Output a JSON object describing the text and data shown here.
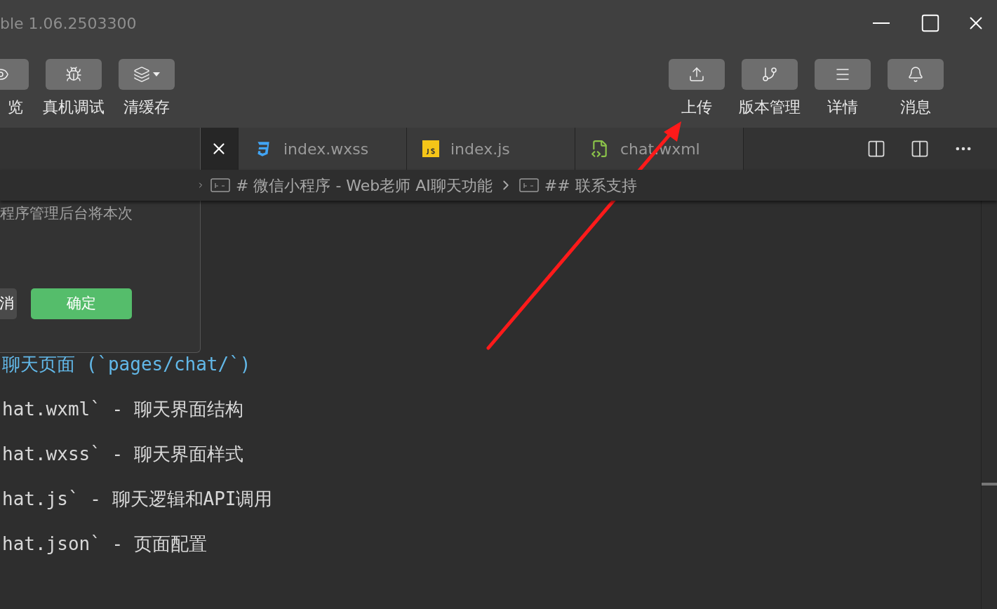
{
  "window": {
    "title": "ble 1.06.2503300"
  },
  "toolbar_left": [
    {
      "label": "览",
      "kind": "eye"
    },
    {
      "label": "真机调试",
      "kind": "bug"
    },
    {
      "label": "清缓存",
      "kind": "layers"
    }
  ],
  "toolbar_right": [
    {
      "label": "上传",
      "kind": "upload"
    },
    {
      "label": "版本管理",
      "kind": "branch"
    },
    {
      "label": "详情",
      "kind": "menu"
    },
    {
      "label": "消息",
      "kind": "bell"
    }
  ],
  "dialog": {
    "text": "程序管理后台将本次",
    "buttons": [
      {
        "label": "消",
        "kind": "secondary"
      },
      {
        "label": "确定",
        "kind": "primary"
      }
    ]
  },
  "tabs": [
    {
      "selected": true,
      "kind": "close"
    },
    {
      "label": "index.wxss",
      "kind": "css",
      "selected": false
    },
    {
      "label": "index.js",
      "kind": "js",
      "selected": false
    },
    {
      "label": "chat.wxml",
      "kind": "wxml",
      "selected": false
    }
  ],
  "breadcrumb": [
    "# 微信小程序 - Web老师 AI聊天功能",
    "## 联系支持"
  ],
  "code_lines": [
    {
      "text": "聊天页面 (`pages/chat/`)",
      "kind": "heading"
    },
    {
      "text": "hat.wxml` - 聊天界面结构",
      "kind": "plain"
    },
    {
      "text": "hat.wxss` - 聊天界面样式",
      "kind": "plain"
    },
    {
      "text": "hat.js` - 聊天逻辑和API调用",
      "kind": "plain"
    },
    {
      "text": "hat.json` - 页面配置",
      "kind": "plain"
    }
  ]
}
